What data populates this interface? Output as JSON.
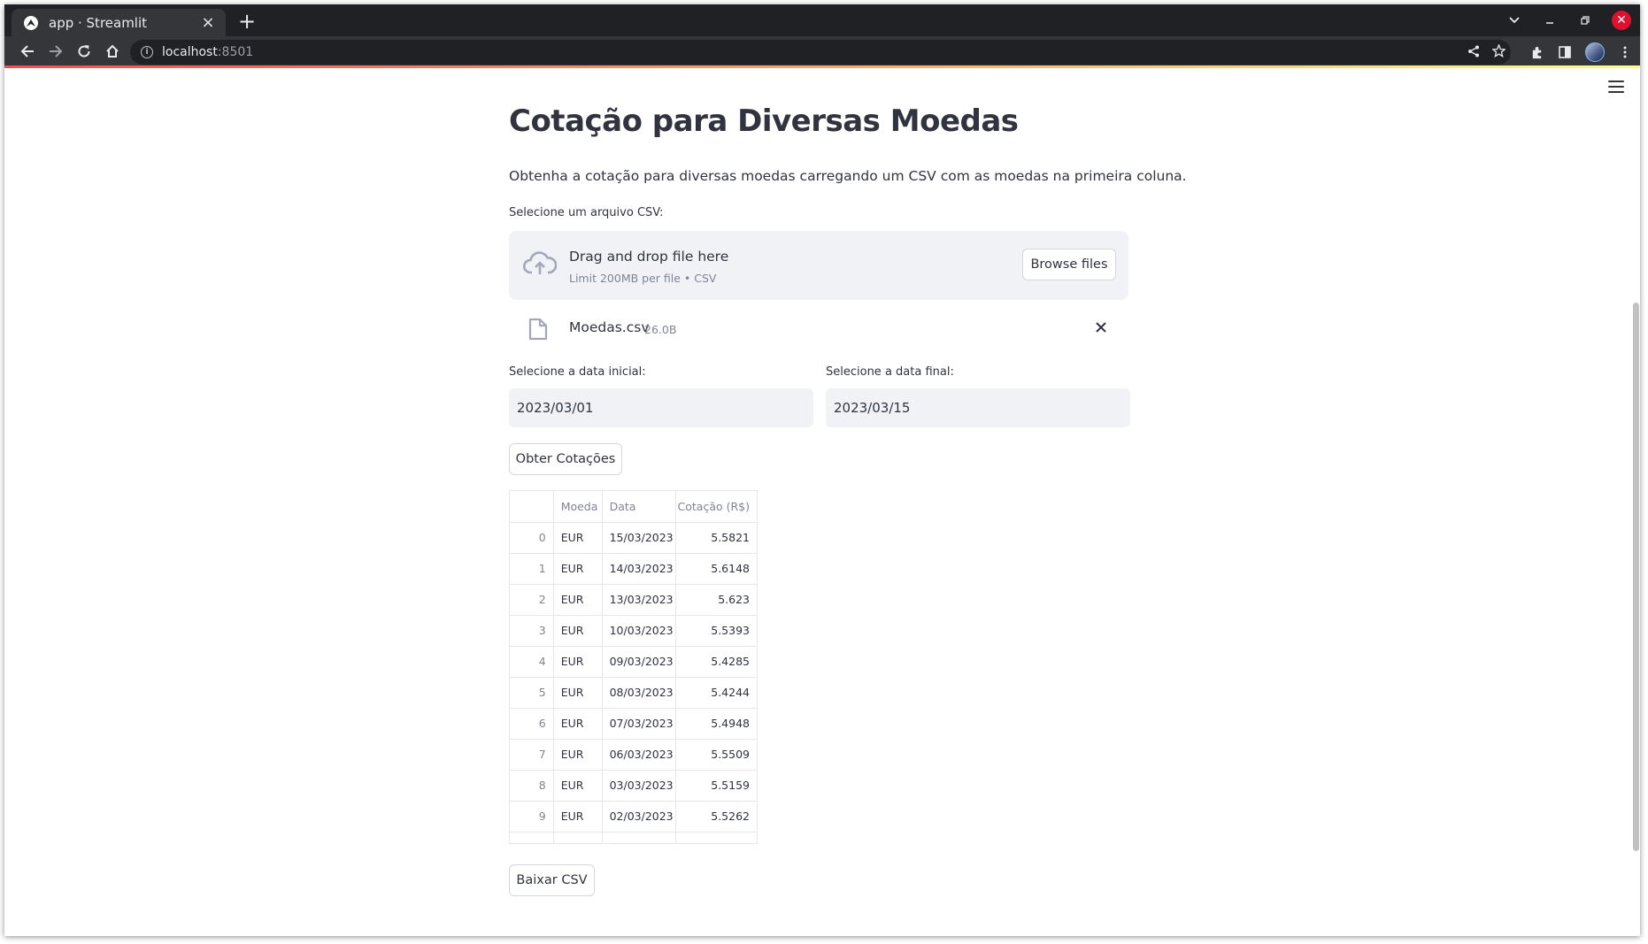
{
  "browser": {
    "tab_title": "app · Streamlit",
    "url_host": "localhost",
    "url_port": ":8501"
  },
  "page": {
    "title": "Cotação para Diversas Moedas",
    "subtitle": "Obtenha a cotação para diversas moedas carregando um CSV com as moedas na primeira coluna."
  },
  "uploader": {
    "label": "Selecione um arquivo CSV:",
    "drop_text": "Drag and drop file here",
    "limit_text": "Limit 200MB per file • CSV",
    "browse_label": "Browse files",
    "file_name": "Moedas.csv",
    "file_size": "26.0B"
  },
  "dates": {
    "start_label": "Selecione a data inicial:",
    "start_value": "2023/03/01",
    "end_label": "Selecione a data final:",
    "end_value": "2023/03/15"
  },
  "actions": {
    "fetch_label": "Obter Cotações",
    "download_label": "Baixar CSV"
  },
  "table": {
    "columns": [
      "",
      "Moeda",
      "Data",
      "Cotação (R$)"
    ],
    "rows": [
      [
        "0",
        "EUR",
        "15/03/2023",
        "5.5821"
      ],
      [
        "1",
        "EUR",
        "14/03/2023",
        "5.6148"
      ],
      [
        "2",
        "EUR",
        "13/03/2023",
        "5.623"
      ],
      [
        "3",
        "EUR",
        "10/03/2023",
        "5.5393"
      ],
      [
        "4",
        "EUR",
        "09/03/2023",
        "5.4285"
      ],
      [
        "5",
        "EUR",
        "08/03/2023",
        "5.4244"
      ],
      [
        "6",
        "EUR",
        "07/03/2023",
        "5.4948"
      ],
      [
        "7",
        "EUR",
        "06/03/2023",
        "5.5509"
      ],
      [
        "8",
        "EUR",
        "03/03/2023",
        "5.5159"
      ],
      [
        "9",
        "EUR",
        "02/03/2023",
        "5.5262"
      ]
    ]
  },
  "icons": {
    "upload": "cloud-upload-icon",
    "file": "file-icon",
    "remove": "close-icon",
    "menu": "hamburger-menu-icon"
  },
  "colors": {
    "accent_gradient_start": "#ff4b4b",
    "accent_gradient_end": "#fffd80",
    "input_bg": "#f0f2f6",
    "text": "#31333f"
  }
}
